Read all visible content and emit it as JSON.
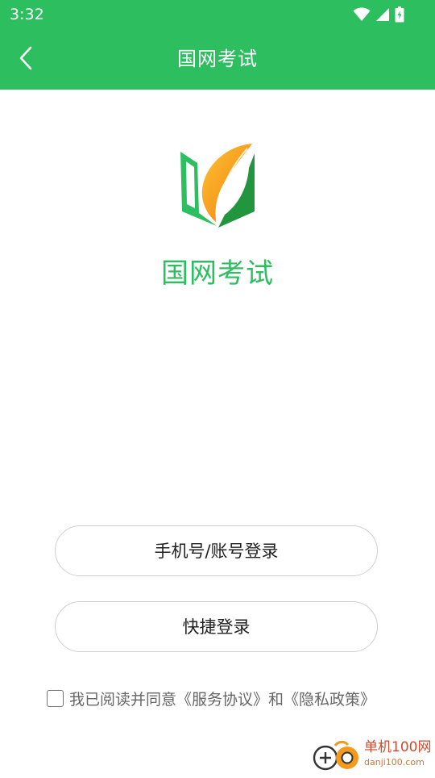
{
  "status_bar": {
    "time": "3:32",
    "icons": [
      "wifi-icon",
      "cell-signal-icon",
      "battery-charging-icon"
    ]
  },
  "app_bar": {
    "title": "国网考试",
    "back_icon": "chevron-left-icon"
  },
  "brand": {
    "name": "国网考试",
    "logo_icon": "leaf-book-logo"
  },
  "buttons": {
    "account_login": "手机号/账号登录",
    "quick_login": "快捷登录"
  },
  "agreement": {
    "checked": false,
    "text": "我已阅读并同意《服务协议》和《隐私政策》"
  },
  "watermark": {
    "site_name": "单机100网",
    "url": "danji100.com"
  },
  "colors": {
    "primary_green": "#2dbe60",
    "logo_orange": "#f39a1c",
    "logo_dark_green": "#22963f",
    "text_dark": "#222222",
    "text_gray": "#666666"
  }
}
